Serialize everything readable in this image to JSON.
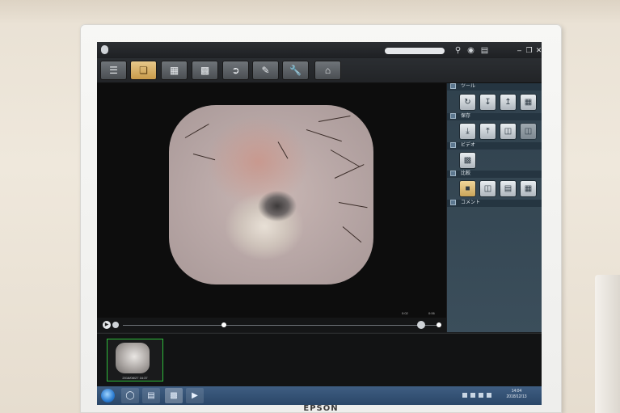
{
  "device": {
    "brand": "EPSON"
  },
  "panel": {
    "sections": [
      {
        "title": "ツール"
      },
      {
        "title": "保存"
      },
      {
        "title": "ビデオ"
      },
      {
        "title": "比較"
      },
      {
        "title": "コメント"
      }
    ]
  },
  "timeline": {
    "start_label": "0:02",
    "end_label": "0:06"
  },
  "thumbnails": [
    {
      "date": "2018/08/27 16:37"
    }
  ],
  "taskbar": {
    "time": "14:04",
    "date": "2018/12/13"
  }
}
